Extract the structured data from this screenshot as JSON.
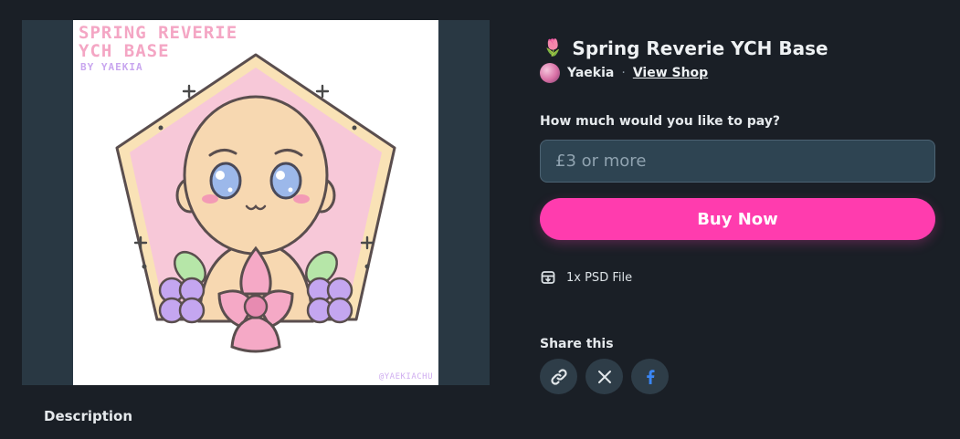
{
  "product": {
    "title": "Spring Reverie YCH Base",
    "title_icon": "tulip-icon",
    "seller": "Yaekia",
    "separator": "·",
    "view_shop": "View Shop"
  },
  "artwork": {
    "title": "Spring Reverie\nYCH Base",
    "byline": "BY YAEKIA",
    "handle": "@YAEKIACHU"
  },
  "payment": {
    "label": "How much would you like to pay?",
    "placeholder": "£3 or more",
    "buy_label": "Buy Now",
    "accent_color": "#ff3cae"
  },
  "files": {
    "summary": "1x PSD File"
  },
  "share": {
    "label": "Share this",
    "buttons": [
      "link-icon",
      "x-icon",
      "facebook-icon"
    ]
  },
  "description": {
    "label": "Description"
  }
}
